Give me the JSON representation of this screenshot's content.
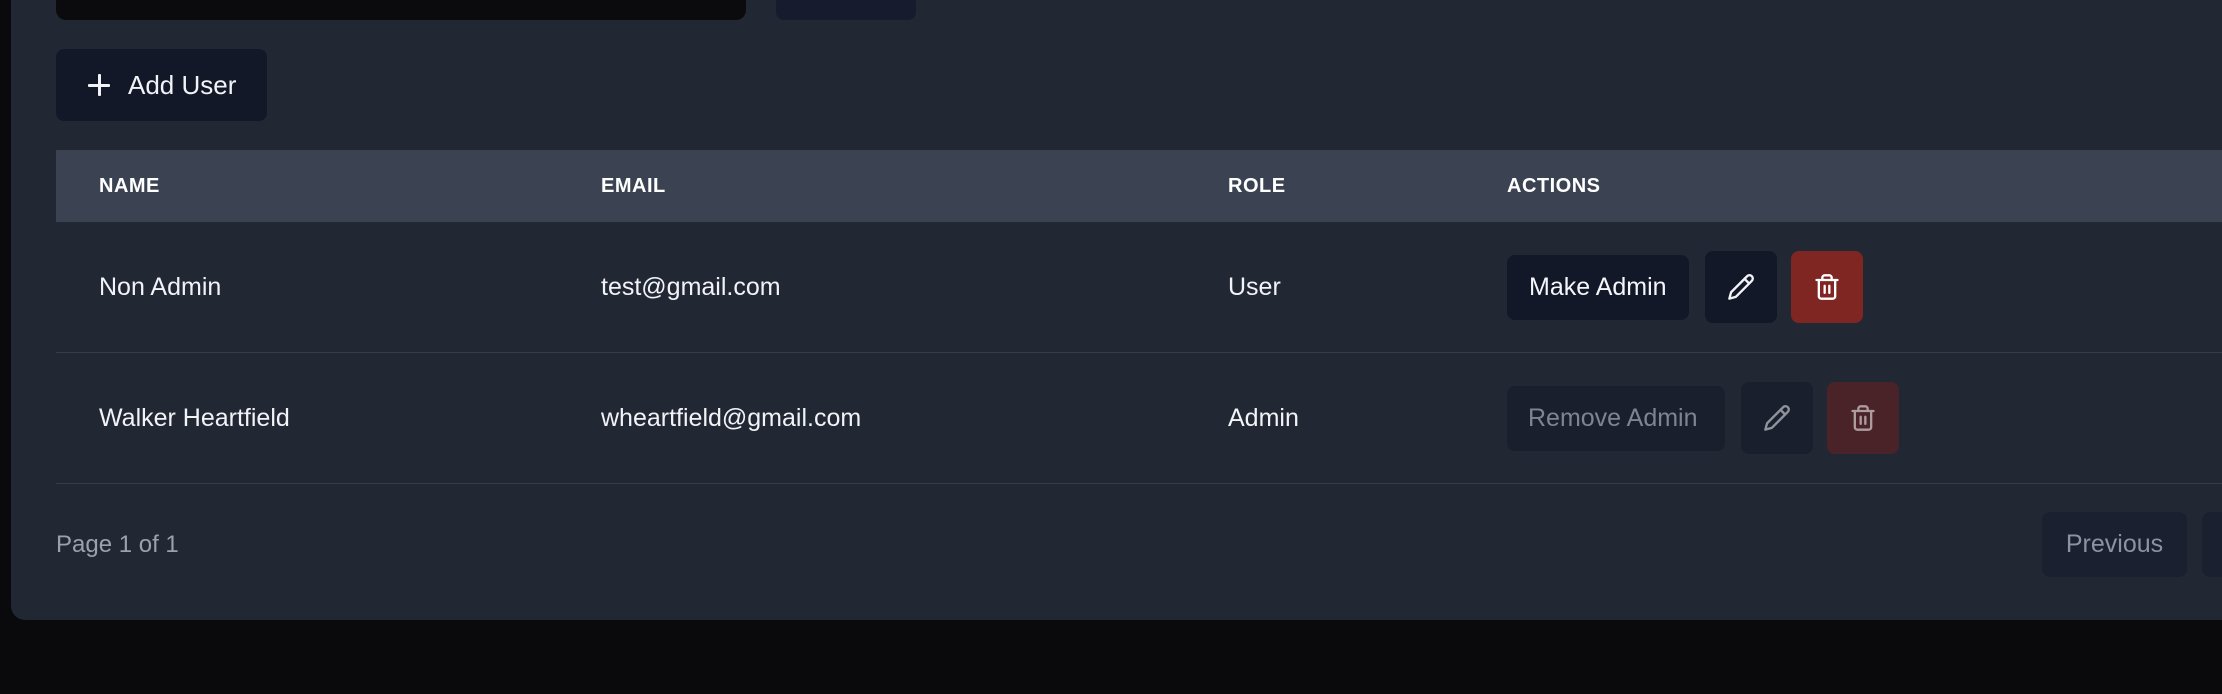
{
  "toolbar": {
    "add_user_label": "Add User"
  },
  "table": {
    "headers": {
      "name": "NAME",
      "email": "EMAIL",
      "role": "ROLE",
      "actions": "ACTIONS"
    },
    "rows": [
      {
        "name": "Non Admin",
        "email": "test@gmail.com",
        "role": "User",
        "action_label": "Make Admin",
        "actions_disabled": false
      },
      {
        "name": "Walker Heartfield",
        "email": "wheartfield@gmail.com",
        "role": "Admin",
        "action_label": "Remove Admin",
        "actions_disabled": true
      }
    ]
  },
  "pagination": {
    "page_text": "Page 1 of 1",
    "previous_label": "Previous"
  },
  "icons": {
    "add": "plus-icon",
    "edit": "pencil-icon",
    "delete": "trash-icon"
  },
  "colors": {
    "panel_bg": "#222734",
    "header_bg": "#3b4252",
    "button_dark": "#121828",
    "delete_red": "#7f2623"
  }
}
